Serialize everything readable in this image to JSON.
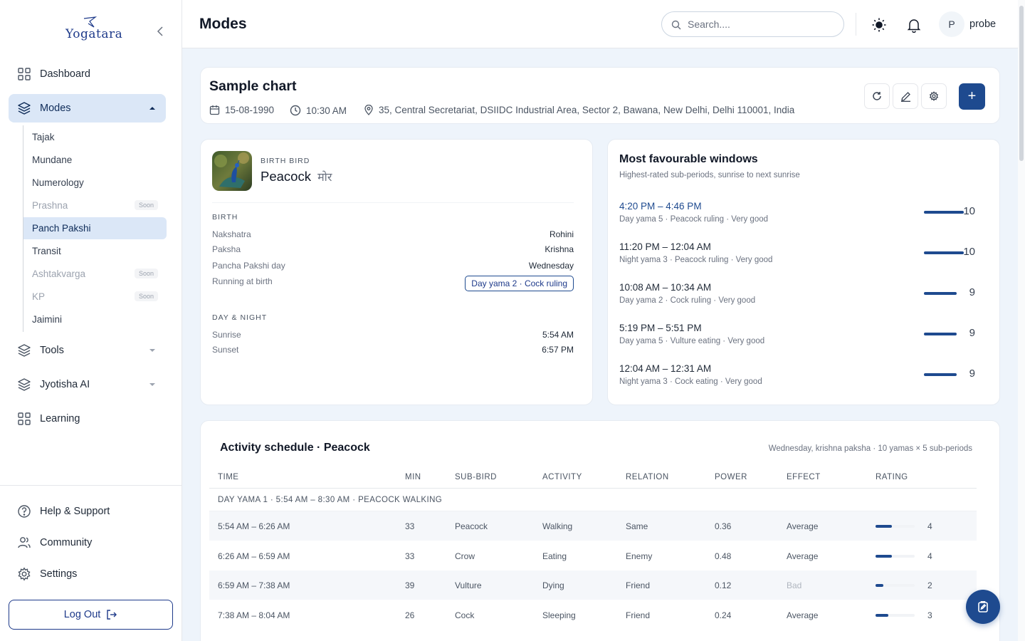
{
  "sidebar": {
    "logo_text": "Yogatara",
    "nav": [
      {
        "label": "Dashboard"
      },
      {
        "label": "Modes"
      },
      {
        "label": "Tools"
      },
      {
        "label": "Jyotisha AI"
      },
      {
        "label": "Learning"
      }
    ],
    "modes_submenu": [
      {
        "label": "Tajak",
        "badge": ""
      },
      {
        "label": "Mundane",
        "badge": ""
      },
      {
        "label": "Numerology",
        "badge": ""
      },
      {
        "label": "Prashna",
        "badge": "Soon"
      },
      {
        "label": "Panch Pakshi",
        "badge": ""
      },
      {
        "label": "Transit",
        "badge": ""
      },
      {
        "label": "Ashtakvarga",
        "badge": "Soon"
      },
      {
        "label": "KP",
        "badge": "Soon"
      },
      {
        "label": "Jaimini",
        "badge": ""
      }
    ],
    "footer": [
      {
        "label": "Help & Support"
      },
      {
        "label": "Community"
      },
      {
        "label": "Settings"
      }
    ],
    "logout_label": "Log Out"
  },
  "header": {
    "title": "Modes",
    "search_placeholder": "Search....",
    "avatar_initial": "P",
    "username": "probe"
  },
  "chart": {
    "title": "Sample chart",
    "date": "15-08-1990",
    "time": "10:30 AM",
    "location": "35, Central Secretariat, DSIIDC Industrial Area, Sector 2, Bawana, New Delhi, Delhi 110001, India",
    "add_label": "+"
  },
  "birth_bird": {
    "eyebrow": "BIRTH BIRD",
    "name": "Peacock",
    "name_local": "मोर",
    "birth_heading": "BIRTH",
    "birth_rows": [
      {
        "key": "Nakshatra",
        "value": "Rohini"
      },
      {
        "key": "Paksha",
        "value": "Krishna"
      },
      {
        "key": "Pancha Pakshi day",
        "value": "Wednesday"
      },
      {
        "key": "Running at birth",
        "value": "Day yama 2 · Cock ruling"
      }
    ],
    "daynight_heading": "DAY & NIGHT",
    "daynight_rows": [
      {
        "key": "Sunrise",
        "value": "5:54 AM"
      },
      {
        "key": "Sunset",
        "value": "6:57 PM"
      }
    ]
  },
  "windows": {
    "title": "Most favourable windows",
    "subtitle": "Highest-rated sub-periods, sunrise to next sunrise",
    "items": [
      {
        "time": "4:20 PM – 4:46 PM",
        "desc": "Day yama 5 · Peacock ruling · Very good",
        "score": "10",
        "score_value": 10
      },
      {
        "time": "11:20 PM – 12:04 AM",
        "desc": "Night yama 3 · Peacock ruling · Very good",
        "score": "10",
        "score_value": 10
      },
      {
        "time": "10:08 AM – 10:34 AM",
        "desc": "Day yama 2 · Cock ruling · Very good",
        "score": "9",
        "score_value": 9
      },
      {
        "time": "5:19 PM – 5:51 PM",
        "desc": "Day yama 5 · Vulture eating · Very good",
        "score": "9",
        "score_value": 9
      },
      {
        "time": "12:04 AM – 12:31 AM",
        "desc": "Night yama 3 · Cock eating · Very good",
        "score": "9",
        "score_value": 9
      }
    ]
  },
  "schedule": {
    "title": "Activity schedule · Peacock",
    "info": "Wednesday, krishna paksha · 10 yamas × 5 sub-periods",
    "columns": [
      "TIME",
      "MIN",
      "SUB-BIRD",
      "ACTIVITY",
      "RELATION",
      "POWER",
      "EFFECT",
      "RATING"
    ],
    "group_label": "DAY YAMA 1 · 5:54 AM – 8:30 AM · PEACOCK WALKING",
    "rows": [
      {
        "time": "5:54 AM – 6:26 AM",
        "min": "33",
        "sub_bird": "Peacock",
        "activity": "Walking",
        "relation": "Same",
        "power": "0.36",
        "effect": "Average",
        "rating": "4",
        "rating_value": 4
      },
      {
        "time": "6:26 AM – 6:59 AM",
        "min": "33",
        "sub_bird": "Crow",
        "activity": "Eating",
        "relation": "Enemy",
        "power": "0.48",
        "effect": "Average",
        "rating": "4",
        "rating_value": 4
      },
      {
        "time": "6:59 AM – 7:38 AM",
        "min": "39",
        "sub_bird": "Vulture",
        "activity": "Dying",
        "relation": "Friend",
        "power": "0.12",
        "effect": "Bad",
        "rating": "2",
        "rating_value": 2
      },
      {
        "time": "7:38 AM – 8:04 AM",
        "min": "26",
        "sub_bird": "Cock",
        "activity": "Sleeping",
        "relation": "Friend",
        "power": "0.24",
        "effect": "Average",
        "rating": "3",
        "rating_value": 3
      }
    ]
  },
  "colors": {
    "brand": "#1e4a8f",
    "active_bg": "#dbe7f7",
    "page_bg": "#eef4fb"
  }
}
